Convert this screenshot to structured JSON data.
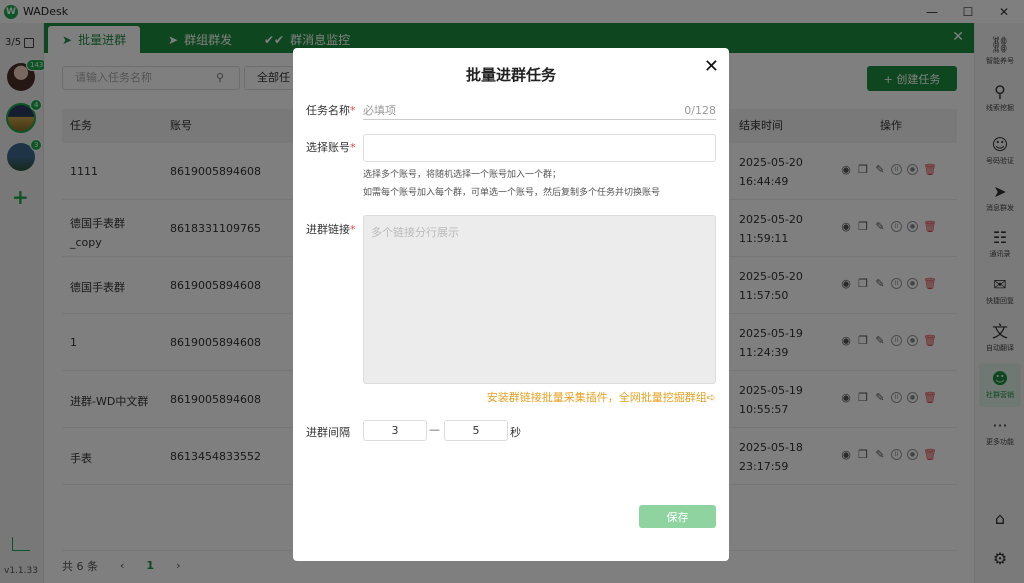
{
  "app": {
    "title": "WADesk",
    "logo": "W",
    "version": "v1.1.33"
  },
  "window": {
    "minimize": "—",
    "maximize": "☐",
    "close": "✕"
  },
  "left": {
    "counter": "3/5",
    "badges": [
      "143",
      "4",
      "3"
    ],
    "add": "+"
  },
  "tabs": [
    {
      "label": "批量进群",
      "icon": "send-icon"
    },
    {
      "label": "群组群发",
      "icon": "send-icon"
    },
    {
      "label": "群消息监控",
      "icon": "double-check-icon"
    }
  ],
  "tab_close": "✕",
  "toolbar": {
    "search_placeholder": "请输入任务名称",
    "filter_label": "全部任",
    "create_label": "+ 创建任务"
  },
  "table": {
    "headers": {
      "task": "任务",
      "account": "账号",
      "end": "结束时间",
      "ops": "操作"
    },
    "rows": [
      {
        "task": "1111",
        "account": "8619005894608",
        "date": "2025-05-20",
        "time": "16:44:49"
      },
      {
        "task": "德国手表群\n_copy",
        "account": "8618331109765",
        "date": "2025-05-20",
        "time": "11:59:11"
      },
      {
        "task": "德国手表群",
        "account": "8619005894608",
        "date": "2025-05-20",
        "time": "11:57:50"
      },
      {
        "task": "1",
        "account": "8619005894608",
        "date": "2025-05-19",
        "time": "11:24:39"
      },
      {
        "task": "进群-WD中文群",
        "account": "8619005894608",
        "date": "2025-05-19",
        "time": "10:55:57"
      },
      {
        "task": "手表",
        "account": "8613454833552",
        "date": "2025-05-18",
        "time": "23:17:59"
      }
    ]
  },
  "footer": {
    "total": "共 6 条",
    "prev": "‹",
    "page": "1",
    "next": "›"
  },
  "right": [
    {
      "label": "智能养号",
      "icon": "share-icon",
      "glyph": "⛓"
    },
    {
      "label": "线索挖掘",
      "icon": "location-icon",
      "glyph": "⚲"
    },
    {
      "label": "号码验证",
      "icon": "user-search-icon",
      "glyph": "☺"
    },
    {
      "label": "消息群发",
      "icon": "send-icon",
      "glyph": "➤"
    },
    {
      "label": "通讯录",
      "icon": "contacts-icon",
      "glyph": "☷"
    },
    {
      "label": "快捷回复",
      "icon": "quick-reply-icon",
      "glyph": "✉"
    },
    {
      "label": "自动翻译",
      "icon": "translate-icon",
      "glyph": "文"
    },
    {
      "label": "社群营销",
      "icon": "group-icon",
      "glyph": "☻"
    },
    {
      "label": "更多功能",
      "icon": "more-icon",
      "glyph": "···"
    }
  ],
  "right_bottom": {
    "store_glyph": "⌂",
    "settings_glyph": "⚙"
  },
  "colors": {
    "brand": "#1d8f3f",
    "link": "#e8a020",
    "required": "#e04848",
    "save_disabled": "#8fd3a0"
  },
  "modal": {
    "title": "批量进群任务",
    "close": "✕",
    "name_label": "任务名称",
    "name_placeholder": "必填项",
    "name_count": "0/128",
    "account_label": "选择账号",
    "hint1": "选择多个账号，将随机选择一个账号加入一个群；",
    "hint2": "如需每个账号加入每个群，可单选一个账号，然后复制多个任务并切换账号",
    "link_label": "进群链接",
    "link_placeholder": "多个链接分行展示",
    "plugin_link": "安装群链接批量采集插件，全网批量挖掘群组➪",
    "interval_label": "进群间隔",
    "interval_min": "3",
    "interval_sep": "—",
    "interval_max": "5",
    "interval_unit": "秒",
    "save": "保存"
  }
}
